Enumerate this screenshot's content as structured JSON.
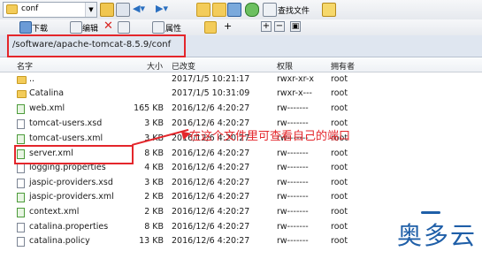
{
  "toolbar": {
    "folder_select_value": "conf",
    "find_files_label": "查找文件"
  },
  "toolbar2": {
    "download_label": "下载",
    "edit_label": "编辑",
    "properties_label": "属性"
  },
  "path": "/software/apache-tomcat-8.5.9/conf",
  "columns": {
    "name": "名字",
    "size": "大小",
    "modified": "已改变",
    "permissions": "权限",
    "owner": "拥有者"
  },
  "files": [
    {
      "name": "..",
      "size": "",
      "modified": "2017/1/5 10:21:17",
      "perms": "rwxr-xr-x",
      "owner": "root",
      "icon": "folder-icon"
    },
    {
      "name": "Catalina",
      "size": "",
      "modified": "2017/1/5 10:31:09",
      "perms": "rwxr-x---",
      "owner": "root",
      "icon": "folder-icon"
    },
    {
      "name": "web.xml",
      "size": "165 KB",
      "modified": "2016/12/6 4:20:27",
      "perms": "rw-------",
      "owner": "root",
      "icon": "xml-file-icon"
    },
    {
      "name": "tomcat-users.xsd",
      "size": "3 KB",
      "modified": "2016/12/6 4:20:27",
      "perms": "rw-------",
      "owner": "root",
      "icon": "file-icon"
    },
    {
      "name": "tomcat-users.xml",
      "size": "3 KB",
      "modified": "2016/12/6 4:20:27",
      "perms": "rw-------",
      "owner": "root",
      "icon": "xml-file-icon"
    },
    {
      "name": "server.xml",
      "size": "8 KB",
      "modified": "2016/12/6 4:20:27",
      "perms": "rw-------",
      "owner": "root",
      "icon": "xml-file-icon"
    },
    {
      "name": "logging.properties",
      "size": "4 KB",
      "modified": "2016/12/6 4:20:27",
      "perms": "rw-------",
      "owner": "root",
      "icon": "file-icon"
    },
    {
      "name": "jaspic-providers.xsd",
      "size": "3 KB",
      "modified": "2016/12/6 4:20:27",
      "perms": "rw-------",
      "owner": "root",
      "icon": "file-icon"
    },
    {
      "name": "jaspic-providers.xml",
      "size": "2 KB",
      "modified": "2016/12/6 4:20:27",
      "perms": "rw-------",
      "owner": "root",
      "icon": "xml-file-icon"
    },
    {
      "name": "context.xml",
      "size": "2 KB",
      "modified": "2016/12/6 4:20:27",
      "perms": "rw-------",
      "owner": "root",
      "icon": "xml-file-icon"
    },
    {
      "name": "catalina.properties",
      "size": "8 KB",
      "modified": "2016/12/6 4:20:27",
      "perms": "rw-------",
      "owner": "root",
      "icon": "file-icon"
    },
    {
      "name": "catalina.policy",
      "size": "13 KB",
      "modified": "2016/12/6 4:20:27",
      "perms": "rw-------",
      "owner": "root",
      "icon": "file-icon"
    }
  ],
  "annotation": "在这个文件里可查看自己的端口",
  "watermark": "奥多云",
  "colors": {
    "annotation_red": "#e4262b",
    "path_bar": "#dfe6f0",
    "watermark_blue": "#1f5fa8"
  }
}
